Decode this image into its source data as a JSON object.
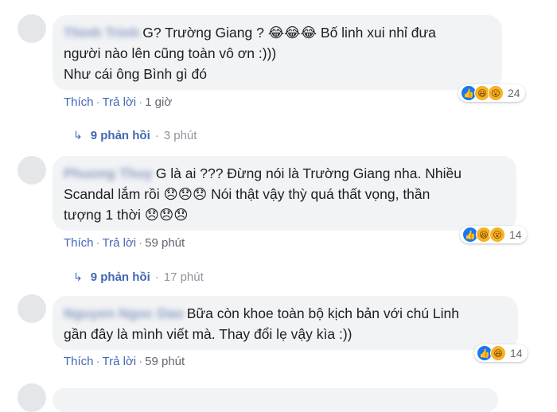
{
  "comments": [
    {
      "author": "Thinh Trinh",
      "lines": [
        "G? Trường Giang ? 😂😂😂 Bố linh xui nhỉ đưa",
        "người nào lên cũng toàn vô ơn :)))",
        "Như cái ông Bình gì đó"
      ],
      "like_label": "Thích",
      "reply_label": "Trả lời",
      "time": "1 giờ",
      "reaction_count": "24",
      "reactions": [
        "like-icon",
        "haha-icon",
        "wow-icon"
      ],
      "replies": {
        "count": "9 phản hồi",
        "time": "3 phút"
      }
    },
    {
      "author": "Phuong Thuy",
      "lines": [
        "G là ai ??? Đừng nói là Trường Giang nha. Nhiều",
        "Scandal lắm rồi 😞😞😞 Nói thật vậy thỳ quá thất vọng, thần",
        "tượng 1 thời 😞😞😞"
      ],
      "like_label": "Thích",
      "reply_label": "Trả lời",
      "time": "59 phút",
      "reaction_count": "14",
      "reactions": [
        "like-icon",
        "haha-icon",
        "wow-icon"
      ],
      "replies": {
        "count": "9 phản hồi",
        "time": "17 phút"
      }
    },
    {
      "author": "Nguyen Ngoc Dao",
      "lines": [
        "Bữa còn khoe toàn bộ kịch bản với chú Linh",
        "gần đây là mình viết mà. Thay đổi lẹ vậy kìa :))"
      ],
      "like_label": "Thích",
      "reply_label": "Trả lời",
      "time": "59 phút",
      "reaction_count": "14",
      "reactions": [
        "like-icon",
        "haha-icon"
      ]
    }
  ],
  "colors": {
    "link": "#4267b2",
    "bubble": "#f2f3f5",
    "like": "#1877f2",
    "haha": "#f7b125"
  }
}
